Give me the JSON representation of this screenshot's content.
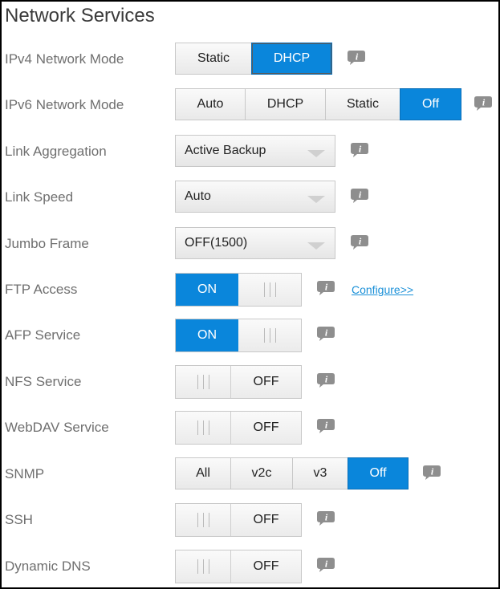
{
  "title": "Network Services",
  "ipv4": {
    "label": "IPv4 Network Mode",
    "options": [
      "Static",
      "DHCP"
    ],
    "selected": "DHCP"
  },
  "ipv6": {
    "label": "IPv6 Network Mode",
    "options": [
      "Auto",
      "DHCP",
      "Static",
      "Off"
    ],
    "selected": "Off"
  },
  "link_aggregation": {
    "label": "Link Aggregation",
    "value": "Active Backup"
  },
  "link_speed": {
    "label": "Link Speed",
    "value": "Auto"
  },
  "jumbo_frame": {
    "label": "Jumbo Frame",
    "value": "OFF(1500)"
  },
  "ftp": {
    "label": "FTP Access",
    "state": "ON",
    "link": "Configure>>"
  },
  "afp": {
    "label": "AFP Service",
    "state": "ON"
  },
  "nfs": {
    "label": "NFS Service",
    "state": "OFF"
  },
  "webdav": {
    "label": "WebDAV Service",
    "state": "OFF"
  },
  "snmp": {
    "label": "SNMP",
    "options": [
      "All",
      "v2c",
      "v3",
      "Off"
    ],
    "selected": "Off"
  },
  "ssh": {
    "label": "SSH",
    "state": "OFF"
  },
  "ddns": {
    "label": "Dynamic DNS",
    "state": "OFF"
  },
  "icons": {
    "info": "info-icon",
    "dropdown": "chevron-down-icon",
    "grip": "toggle-grip"
  },
  "colors": {
    "accent": "#0a86db",
    "label_text": "#6f6f6f",
    "link": "#1a90d8",
    "info_icon": "#8e8e8e"
  }
}
